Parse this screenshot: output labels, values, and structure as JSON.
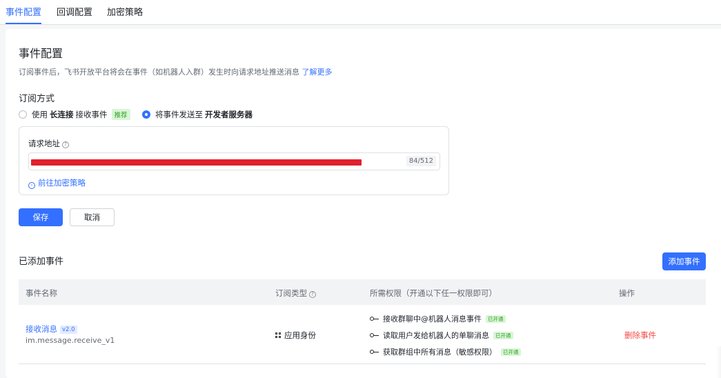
{
  "tabs": [
    {
      "label": "事件配置",
      "active": true
    },
    {
      "label": "回调配置",
      "active": false
    },
    {
      "label": "加密策略",
      "active": false
    }
  ],
  "config": {
    "title": "事件配置",
    "description": "订阅事件后，飞书开放平台将会在事件（如机器人入群）发生时向请求地址推送消息",
    "learn_more": "了解更多",
    "subscribe_method_title": "订阅方式",
    "option1": {
      "prefix": "使用",
      "bold": "长连接",
      "suffix": "接收事件",
      "tag": "推荐",
      "checked": false
    },
    "option2": {
      "prefix": "将事件发送至",
      "bold": "开发者服务器",
      "checked": true
    },
    "url_label": "请求地址",
    "url_count": "84/512",
    "goto_link": "前往加密策略",
    "save_label": "保存",
    "cancel_label": "取消"
  },
  "events": {
    "title": "已添加事件",
    "add_button": "添加事件",
    "columns": [
      "事件名称",
      "订阅类型",
      "所需权限（开通以下任一权限即可）",
      "操作"
    ],
    "rows": [
      {
        "name": "接收消息",
        "version": "v2.0",
        "id": "im.message.receive_v1",
        "sub_type": "应用身份",
        "permissions": [
          {
            "label": "接收群聊中@机器人消息事件",
            "status": "已开通"
          },
          {
            "label": "读取用户发给机器人的单聊消息",
            "status": "已开通"
          },
          {
            "label": "获取群组中所有消息（敏感权限）",
            "status": "已开通"
          }
        ],
        "action": "删除事件"
      }
    ]
  },
  "colors": {
    "accent": "#3370ff",
    "danger": "#f54a45",
    "success": "#2ea121",
    "redaction": "#e0202c"
  },
  "icons": [
    "help-icon",
    "circle-arrow-icon",
    "grid-icon",
    "key-icon"
  ]
}
